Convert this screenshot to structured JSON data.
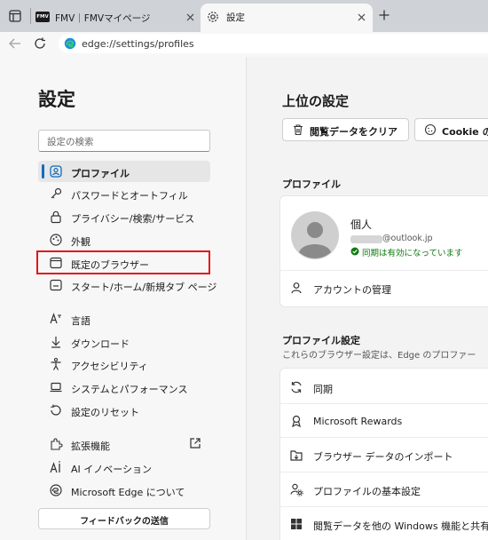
{
  "browser": {
    "tabs": [
      {
        "label": "FMV｜FMVマイページ",
        "favicon_text": "FMV"
      },
      {
        "label": "設定"
      }
    ],
    "address": "edge://settings/profiles"
  },
  "sidebar": {
    "title": "設定",
    "search_placeholder": "設定の検索",
    "items": [
      {
        "label": "プロファイル",
        "icon": "profile-icon",
        "selected": true
      },
      {
        "label": "パスワードとオートフィル",
        "icon": "key-icon"
      },
      {
        "label": "プライバシー/検索/サービス",
        "icon": "lock-icon"
      },
      {
        "label": "外観",
        "icon": "appearance-icon"
      },
      {
        "label": "既定のブラウザー",
        "icon": "browser-icon",
        "highlighted": true
      },
      {
        "label": "スタート/ホーム/新規タブ ページ",
        "icon": "newtab-icon"
      },
      {
        "label": "言語",
        "icon": "language-icon"
      },
      {
        "label": "ダウンロード",
        "icon": "download-icon"
      },
      {
        "label": "アクセシビリティ",
        "icon": "accessibility-icon"
      },
      {
        "label": "システムとパフォーマンス",
        "icon": "laptop-icon"
      },
      {
        "label": "設定のリセット",
        "icon": "reset-icon"
      },
      {
        "label": "拡張機能",
        "icon": "extensions-icon"
      },
      {
        "label": "AI イノベーション",
        "icon": "ai-icon"
      },
      {
        "label": "Microsoft Edge について",
        "icon": "edge-icon"
      }
    ],
    "feedback_label": "フィードバックの送信"
  },
  "main": {
    "title": "上位の設定",
    "clear_button": "閲覧データをクリア",
    "cookie_button": "Cookie の",
    "profile_section": "プロファイル",
    "profile": {
      "name": "個人",
      "email": "@outlook.jp",
      "sync_status": "同期は有効になっています",
      "manage_account": "アカウントの管理"
    },
    "profile_settings_title": "プロファイル設定",
    "profile_settings_desc": "これらのブラウザー設定は、Edge のプロファー",
    "rows": [
      {
        "label": "同期",
        "icon": "sync-icon"
      },
      {
        "label": "Microsoft Rewards",
        "icon": "rewards-icon"
      },
      {
        "label": "ブラウザー データのインポート",
        "icon": "import-icon"
      },
      {
        "label": "プロファイルの基本設定",
        "icon": "profile-settings-icon"
      },
      {
        "label": "閲覧データを他の Windows 機能と共有",
        "icon": "windows-icon"
      }
    ]
  },
  "colors": {
    "accent": "#0f6cbd",
    "highlight_box": "#e3151a",
    "sync_ok": "#107c10"
  }
}
